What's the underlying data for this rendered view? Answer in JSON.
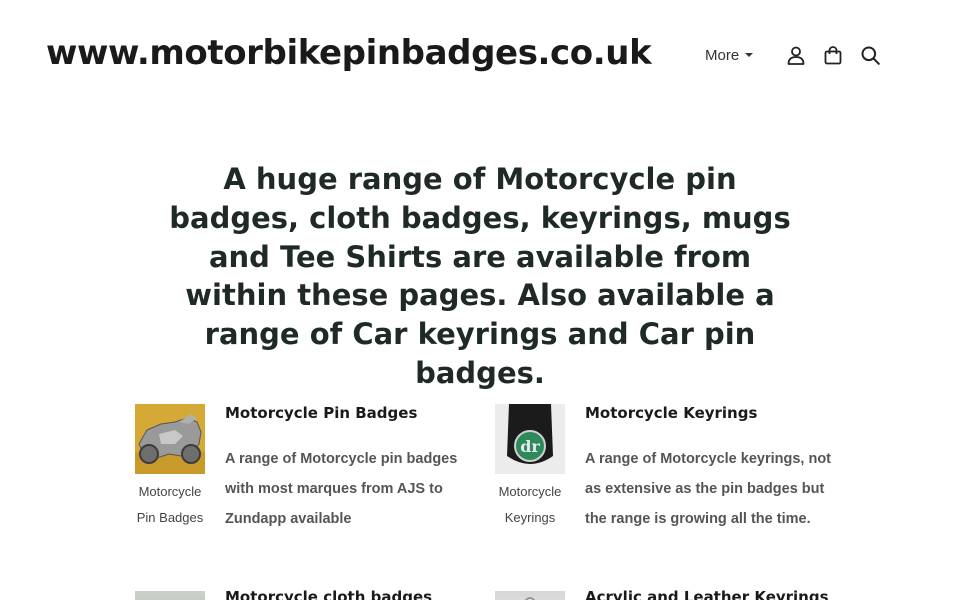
{
  "header": {
    "site_title": "www.motorbikepinbadges.co.uk",
    "nav_more_label": "More",
    "icons": [
      "user-icon",
      "shopping-bag-icon",
      "search-icon"
    ]
  },
  "hero": {
    "text": "A huge range of Motorcycle pin badges, cloth badges, keyrings, mugs and Tee Shirts are available from within these pages. Also available a range of Car keyrings and Car pin badges."
  },
  "products": [
    {
      "title": "Motorcycle Pin Badges",
      "caption": "Motorcycle Pin Badges",
      "description": "A range of Motorcycle pin badges with most marques from AJS to Zundapp available"
    },
    {
      "title": "Motorcycle Keyrings",
      "caption": "Motorcycle Keyrings",
      "description": "A range of Motorcycle keyrings, not as extensive as the pin badges but the range is growing all the time."
    },
    {
      "title": "Motorcycle cloth badges"
    },
    {
      "title": "Acrylic and Leather Keyrings"
    }
  ],
  "colors": {
    "title_text": "#1a1a1a",
    "hero_text": "#1f2a27",
    "body_text": "#555555",
    "keyring_green": "#2e8a5a"
  }
}
